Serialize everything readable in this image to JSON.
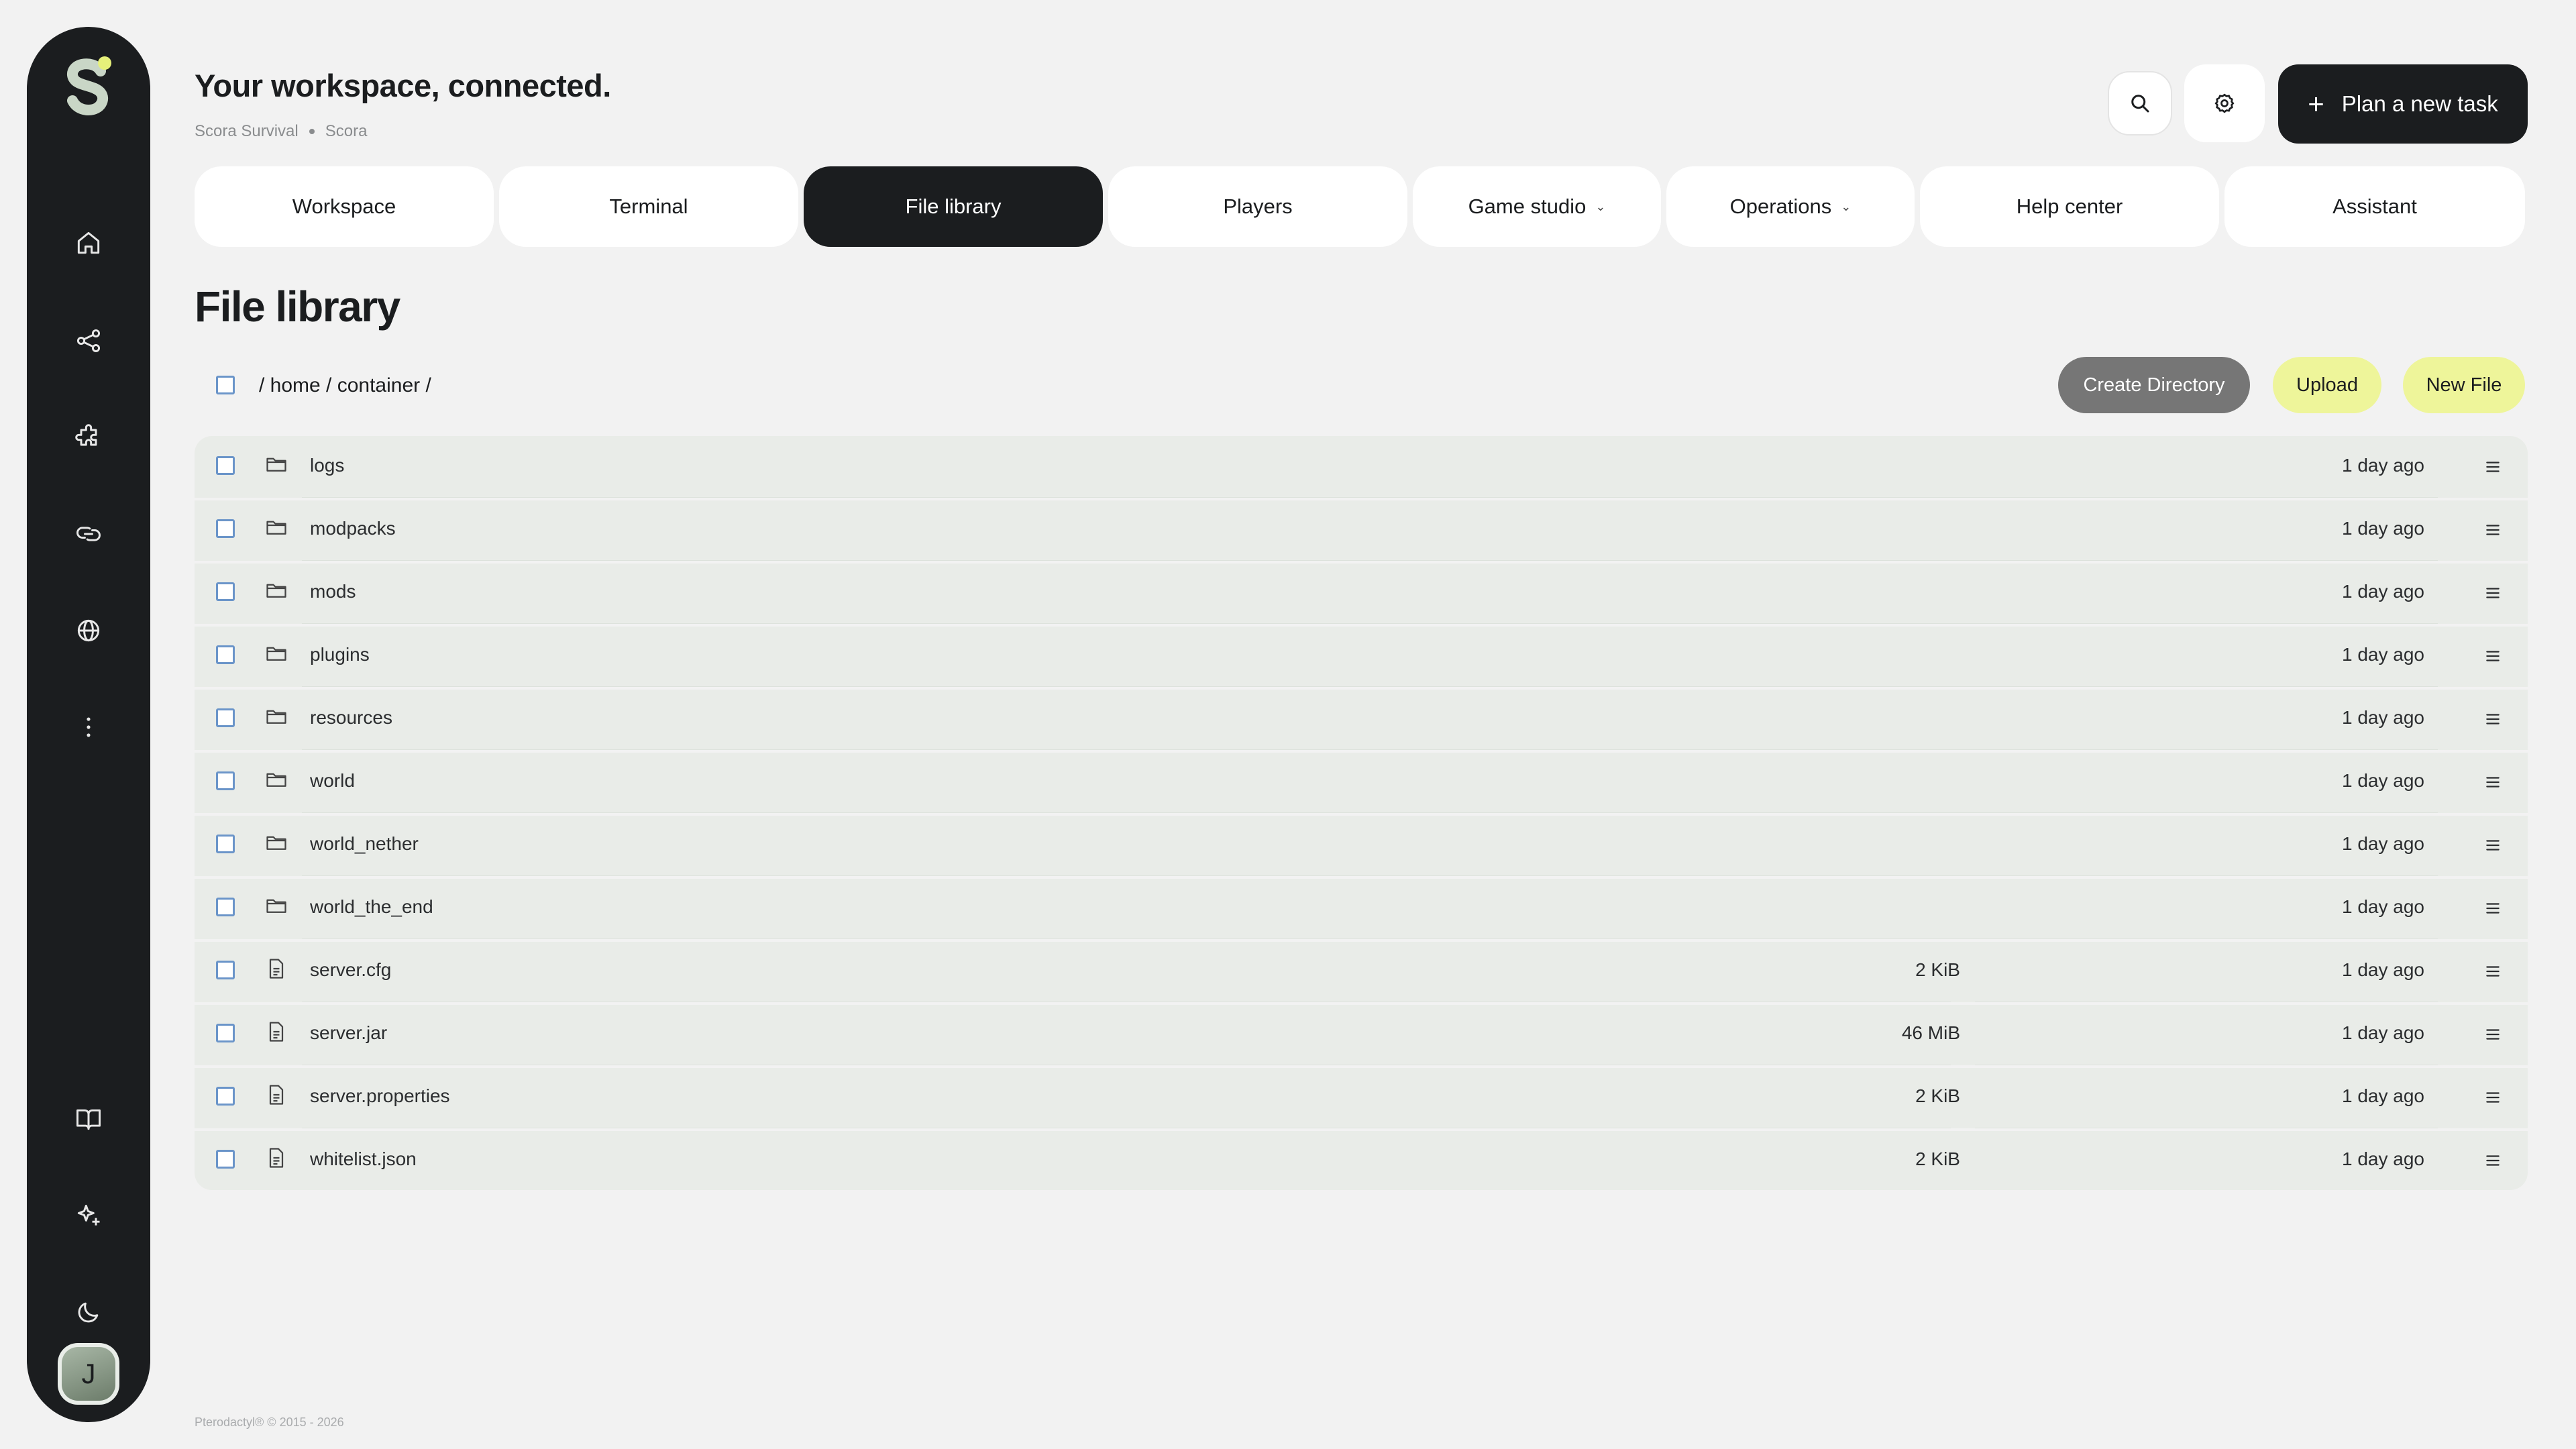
{
  "header": {
    "title": "Your workspace, connected.",
    "breadcrumb": [
      "Scora Survival",
      "Scora"
    ],
    "plan_button": "Plan a new task"
  },
  "tabs": [
    {
      "label": "Workspace",
      "chevron": false
    },
    {
      "label": "Terminal",
      "chevron": false
    },
    {
      "label": "File library",
      "chevron": false,
      "active": true
    },
    {
      "label": "Players",
      "chevron": false
    },
    {
      "label": "Game studio",
      "chevron": true
    },
    {
      "label": "Operations",
      "chevron": true
    },
    {
      "label": "Help center",
      "chevron": false
    },
    {
      "label": "Assistant",
      "chevron": false
    }
  ],
  "section": {
    "title": "File library",
    "path": "/ home / container /",
    "create_directory": "Create Directory",
    "upload": "Upload",
    "new_file": "New File"
  },
  "files": [
    {
      "name": "logs",
      "type": "folder",
      "size": "",
      "modified": "1 day ago"
    },
    {
      "name": "modpacks",
      "type": "folder",
      "size": "",
      "modified": "1 day ago"
    },
    {
      "name": "mods",
      "type": "folder",
      "size": "",
      "modified": "1 day ago"
    },
    {
      "name": "plugins",
      "type": "folder",
      "size": "",
      "modified": "1 day ago"
    },
    {
      "name": "resources",
      "type": "folder",
      "size": "",
      "modified": "1 day ago"
    },
    {
      "name": "world",
      "type": "folder",
      "size": "",
      "modified": "1 day ago"
    },
    {
      "name": "world_nether",
      "type": "folder",
      "size": "",
      "modified": "1 day ago"
    },
    {
      "name": "world_the_end",
      "type": "folder",
      "size": "",
      "modified": "1 day ago"
    },
    {
      "name": "server.cfg",
      "type": "file",
      "size": "2 KiB",
      "modified": "1 day ago"
    },
    {
      "name": "server.jar",
      "type": "file",
      "size": "46 MiB",
      "modified": "1 day ago"
    },
    {
      "name": "server.properties",
      "type": "file",
      "size": "2 KiB",
      "modified": "1 day ago"
    },
    {
      "name": "whitelist.json",
      "type": "file",
      "size": "2 KiB",
      "modified": "1 day ago"
    }
  ],
  "user": {
    "avatar_initial": "J"
  },
  "footer": "Pterodactyl® © 2015 - 2026",
  "colors": {
    "accent": "#eef59a",
    "dark": "#1b1d1f",
    "checkbox": "#6b95c9"
  },
  "sidebar_icons": [
    "home-icon",
    "share-icon",
    "puzzle-icon",
    "link-icon",
    "globe-icon",
    "more-vertical-icon",
    "book-icon",
    "sparkles-icon",
    "moon-icon"
  ]
}
